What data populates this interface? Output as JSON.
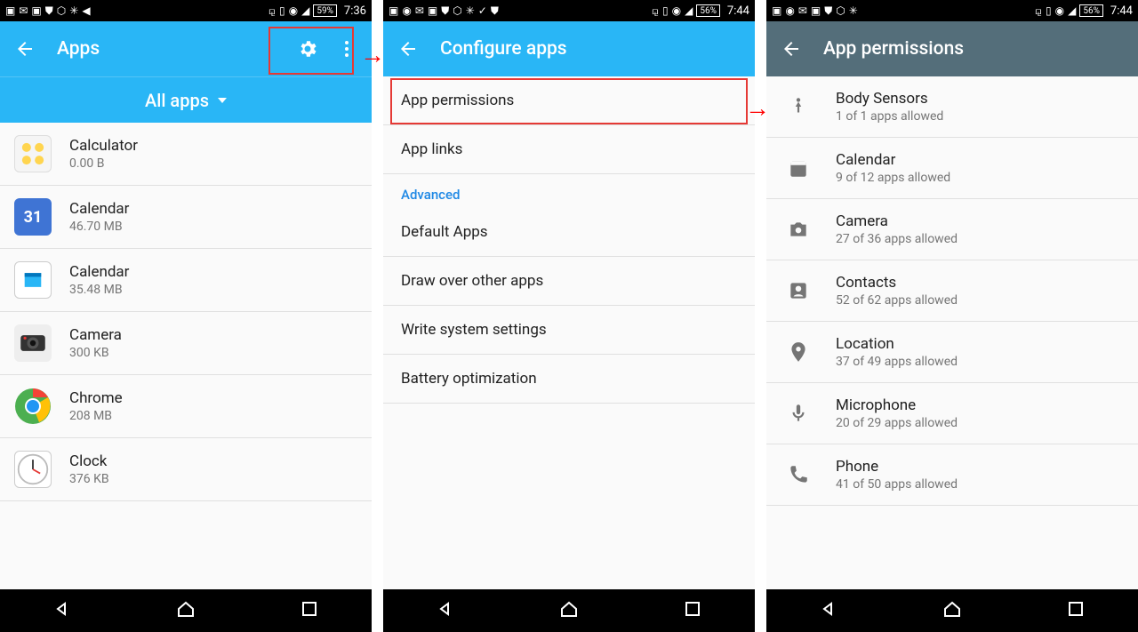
{
  "screens": {
    "apps": {
      "status": {
        "battery": "59%",
        "time": "7:36"
      },
      "title": "Apps",
      "filter": "All apps",
      "items": [
        {
          "label": "Calculator",
          "sub": "0.00 B"
        },
        {
          "label": "Calendar",
          "sub": "46.70 MB"
        },
        {
          "label": "Calendar",
          "sub": "35.48 MB"
        },
        {
          "label": "Camera",
          "sub": "300 KB"
        },
        {
          "label": "Chrome",
          "sub": "208 MB"
        },
        {
          "label": "Clock",
          "sub": "376 KB"
        }
      ]
    },
    "configure": {
      "status": {
        "battery": "56%",
        "time": "7:44"
      },
      "title": "Configure apps",
      "rows": [
        "App permissions",
        "App links"
      ],
      "advanced_label": "Advanced",
      "advanced_rows": [
        "Default Apps",
        "Draw over other apps",
        "Write system settings",
        "Battery optimization"
      ]
    },
    "permissions": {
      "status": {
        "battery": "56%",
        "time": "7:44"
      },
      "title": "App permissions",
      "items": [
        {
          "label": "Body Sensors",
          "sub": "1 of 1 apps allowed"
        },
        {
          "label": "Calendar",
          "sub": "9 of 12 apps allowed"
        },
        {
          "label": "Camera",
          "sub": "27 of 36 apps allowed"
        },
        {
          "label": "Contacts",
          "sub": "52 of 62 apps allowed"
        },
        {
          "label": "Location",
          "sub": "37 of 49 apps allowed"
        },
        {
          "label": "Microphone",
          "sub": "20 of 29 apps allowed"
        },
        {
          "label": "Phone",
          "sub": "41 of 50 apps allowed"
        }
      ]
    }
  }
}
